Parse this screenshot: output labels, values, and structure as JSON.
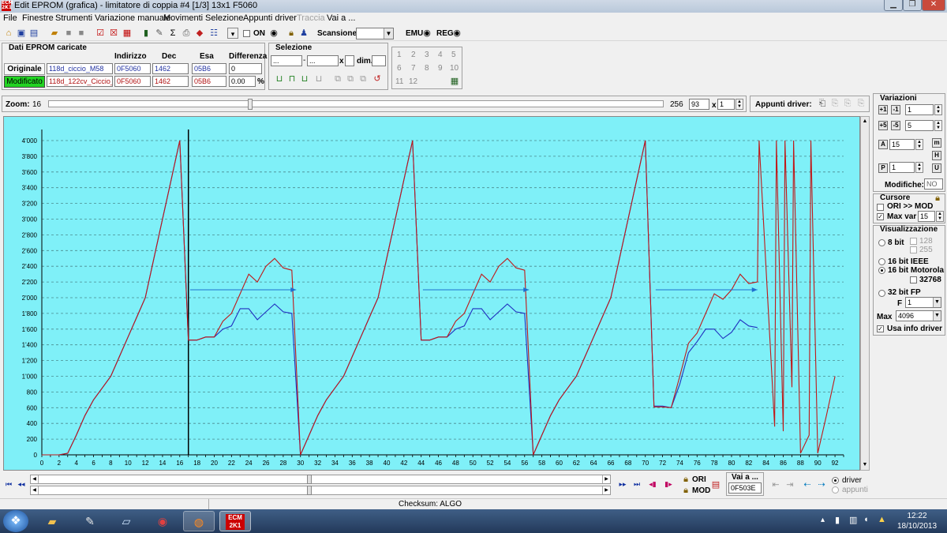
{
  "window": {
    "title": "Edit EPROM (grafica) - limitatore di coppia #4  [1/3]  13x1  F5060"
  },
  "menu": [
    "File",
    "Finestre",
    "Strumenti",
    "Variazione manuale",
    "Movimenti",
    "Selezione",
    "Appunti driver",
    "Traccia",
    "Vai a ..."
  ],
  "toolbar": {
    "on_label": "ON",
    "scansione_label": "Scansione",
    "emu_label": "EMU",
    "reg_label": "REG"
  },
  "eprom": {
    "group_title": "Dati EPROM caricate",
    "headers": {
      "indirizzo": "Indirizzo",
      "dec": "Dec",
      "esa": "Esa",
      "differenza": "Differenza"
    },
    "originale": {
      "label": "Originale",
      "file": "118d_ciccio_M58",
      "indirizzo": "0F5060",
      "dec": "1462",
      "esa": "05B6",
      "diff": "0"
    },
    "modificato": {
      "label": "Modificato",
      "file": "118d_122cv_Ciccio_4",
      "indirizzo": "0F5060",
      "dec": "1462",
      "esa": "05B6",
      "diff": "0.00",
      "pct": "%"
    }
  },
  "selezione": {
    "title": "Selezione",
    "from": "...",
    "to": "...",
    "x": "x",
    "dim": "dim."
  },
  "numpad": [
    "1",
    "2",
    "3",
    "4",
    "5",
    "6",
    "7",
    "8",
    "9",
    "10",
    "11",
    "12"
  ],
  "zoom": {
    "label": "Zoom:",
    "min": "16",
    "max": "256",
    "value": "93",
    "x": "x",
    "mult": "1"
  },
  "appunti": {
    "label": "Appunti driver:"
  },
  "variazioni": {
    "title": "Variazioni",
    "v1": "1",
    "v2": "5",
    "v3": "15",
    "v4": "1",
    "modifiche_label": "Modifiche:",
    "modifiche_value": "NO"
  },
  "cursore": {
    "title": "Cursore",
    "ori_mod": "ORI >> MOD",
    "max_var": "Max var",
    "max_var_value": "15"
  },
  "visualizzazione": {
    "title": "Visualizzazione",
    "opt_8bit": "8 bit",
    "v128": "128",
    "v255": "255",
    "opt_16ieee": "16 bit IEEE",
    "opt_16moto": "16 bit Motorola",
    "v32768": "32768",
    "opt_32fp": "32 bit FP",
    "f_label": "F",
    "f_value": "1",
    "max_label": "Max",
    "max_value": "4096",
    "usa_info": "Usa info driver"
  },
  "bottom": {
    "ori": "ORI",
    "mod": "MOD",
    "vai_a": "Vai a ...",
    "vai_a_value": "0F503E",
    "driver": "driver",
    "appunti": "appunti"
  },
  "status": {
    "checksum": "Checksum: ALGO"
  },
  "clock": {
    "time": "12:22",
    "date": "18/10/2013"
  },
  "colors": {
    "plot_bg": "#7ff0f8",
    "ori_line": "#2030c0",
    "mod_line": "#c01818",
    "arrow": "#1e6fd0"
  },
  "chart_data": {
    "type": "line",
    "xlim": [
      0,
      93
    ],
    "ylim": [
      0,
      4000
    ],
    "x_ticks": [
      0,
      2,
      4,
      6,
      8,
      10,
      12,
      14,
      16,
      18,
      20,
      22,
      24,
      26,
      28,
      30,
      32,
      34,
      36,
      38,
      40,
      42,
      44,
      46,
      48,
      50,
      52,
      54,
      56,
      58,
      60,
      62,
      64,
      66,
      68,
      70,
      72,
      74,
      76,
      78,
      80,
      82,
      84,
      86,
      88,
      90,
      92
    ],
    "y_ticks": [
      0,
      200,
      400,
      600,
      800,
      1000,
      1200,
      1400,
      1600,
      1800,
      2000,
      2200,
      2400,
      2600,
      2800,
      3000,
      3200,
      3400,
      3600,
      3800,
      4000
    ],
    "y_tick_labels": [
      "0",
      "200",
      "400",
      "600",
      "800",
      "1'000",
      "1'200",
      "1'400",
      "1'600",
      "1'800",
      "2'000",
      "2'200",
      "2'400",
      "2'600",
      "2'800",
      "3'000",
      "3'200",
      "3'400",
      "3'600",
      "3'800",
      "4'000"
    ],
    "cursor_x": 17,
    "series": [
      {
        "x": [
          0,
          1,
          2,
          3,
          4,
          5,
          6,
          7,
          8,
          9,
          10,
          11,
          12,
          13,
          14,
          15,
          16,
          17,
          18,
          19,
          20,
          21,
          22,
          23,
          24,
          25,
          26,
          27,
          28,
          29,
          30,
          31,
          32,
          33,
          34,
          35,
          36,
          37,
          38,
          39,
          40,
          41,
          42,
          43,
          44,
          45,
          46,
          47,
          48,
          49,
          50,
          51,
          52,
          53,
          54,
          55,
          56,
          57,
          58,
          59,
          60,
          61,
          62,
          63,
          64,
          65,
          66,
          67,
          68,
          69,
          70,
          71,
          72,
          73,
          74,
          75,
          76,
          77,
          78,
          79,
          80,
          81,
          82,
          83
        ],
        "y": [
          0,
          0,
          0,
          20,
          250,
          500,
          700,
          850,
          1000,
          1250,
          1500,
          1750,
          2000,
          2500,
          3000,
          3500,
          4000,
          1460,
          1460,
          1500,
          1500,
          1600,
          1640,
          1860,
          1860,
          1720,
          1820,
          1920,
          1820,
          1800,
          0,
          250,
          500,
          700,
          850,
          1000,
          1250,
          1500,
          1750,
          2000,
          2500,
          3000,
          3500,
          4000,
          1460,
          1460,
          1500,
          1500,
          1600,
          1640,
          1860,
          1860,
          1720,
          1820,
          1920,
          1820,
          1800,
          0,
          250,
          500,
          700,
          850,
          1000,
          1250,
          1500,
          1750,
          2000,
          2500,
          3000,
          3500,
          4000,
          620,
          620,
          600,
          900,
          1300,
          1440,
          1600,
          1600,
          1480,
          1560,
          1720,
          1640,
          1620
        ]
      },
      {
        "x": [
          0,
          1,
          2,
          3,
          4,
          5,
          6,
          7,
          8,
          9,
          10,
          11,
          12,
          13,
          14,
          15,
          16,
          17,
          18,
          19,
          20,
          21,
          22,
          23,
          24,
          25,
          26,
          27,
          28,
          29,
          30,
          31,
          32,
          33,
          34,
          35,
          36,
          37,
          38,
          39,
          40,
          41,
          42,
          43,
          44,
          45,
          46,
          47,
          48,
          49,
          50,
          51,
          52,
          53,
          54,
          55,
          56,
          57,
          58,
          59,
          60,
          61,
          62,
          63,
          64,
          65,
          66,
          67,
          68,
          69,
          70,
          71,
          72,
          73,
          74,
          75,
          76,
          77,
          78,
          79,
          80,
          81,
          82,
          83,
          83.2,
          85,
          85.2,
          86,
          86.2,
          87,
          87.2,
          88,
          89,
          89.2,
          90,
          91,
          92
        ],
        "y": [
          0,
          0,
          0,
          20,
          250,
          500,
          700,
          850,
          1000,
          1250,
          1500,
          1750,
          2000,
          2500,
          3000,
          3500,
          4000,
          1460,
          1460,
          1500,
          1500,
          1700,
          1800,
          2050,
          2300,
          2200,
          2400,
          2500,
          2380,
          2350,
          0,
          250,
          500,
          700,
          850,
          1000,
          1250,
          1500,
          1750,
          2000,
          2500,
          3000,
          3500,
          4000,
          1460,
          1460,
          1500,
          1500,
          1700,
          1800,
          2050,
          2300,
          2200,
          2400,
          2500,
          2380,
          2350,
          0,
          250,
          500,
          700,
          850,
          1000,
          1250,
          1500,
          1750,
          2000,
          2500,
          3000,
          3500,
          4000,
          610,
          610,
          600,
          1000,
          1420,
          1550,
          1800,
          2050,
          1980,
          2100,
          2300,
          2180,
          2200,
          4000,
          360,
          4000,
          300,
          4000,
          860,
          4000,
          20,
          250,
          4000,
          20,
          500,
          1000
        ]
      }
    ],
    "arrows": [
      {
        "x1": 17.2,
        "x2": 29.5,
        "y": 2100
      },
      {
        "x1": 44.2,
        "x2": 56.5,
        "y": 2100
      },
      {
        "x1": 71.2,
        "x2": 83,
        "y": 2100
      }
    ]
  }
}
